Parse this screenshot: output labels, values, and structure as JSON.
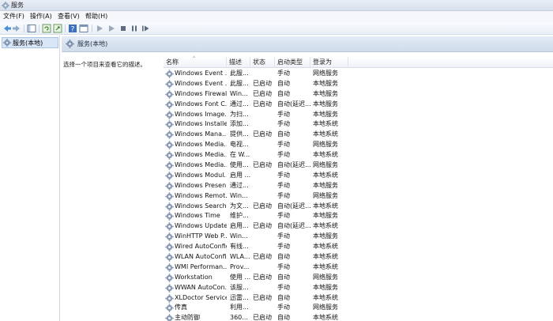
{
  "window": {
    "title": "服务"
  },
  "menu": [
    "文件(F)",
    "操作(A)",
    "查看(V)",
    "帮助(H)"
  ],
  "tree": {
    "root_label": "服务(本地)"
  },
  "main": {
    "header": "服务(本地)",
    "description_hint": "选择一个项目来查看它的描述。",
    "columns": [
      "名称",
      "描述",
      "状态",
      "启动类型",
      "登录为"
    ]
  },
  "services": [
    {
      "name": "Windows Event ...",
      "desc": "此服...",
      "status": "",
      "startup": "手动",
      "logon": "网络服务"
    },
    {
      "name": "Windows Event ...",
      "desc": "此服...",
      "status": "已启动",
      "startup": "自动",
      "logon": "本地服务"
    },
    {
      "name": "Windows Firewall",
      "desc": "Win...",
      "status": "已启动",
      "startup": "自动",
      "logon": "本地服务"
    },
    {
      "name": "Windows Font C...",
      "desc": "通过...",
      "status": "已启动",
      "startup": "自动(延迟...",
      "logon": "本地服务"
    },
    {
      "name": "Windows Image...",
      "desc": "为扫...",
      "status": "",
      "startup": "手动",
      "logon": "本地服务"
    },
    {
      "name": "Windows Installer",
      "desc": "添加...",
      "status": "",
      "startup": "手动",
      "logon": "本地系统"
    },
    {
      "name": "Windows Mana...",
      "desc": "提供...",
      "status": "已启动",
      "startup": "自动",
      "logon": "本地系统"
    },
    {
      "name": "Windows Media...",
      "desc": "电视...",
      "status": "",
      "startup": "手动",
      "logon": "网络服务"
    },
    {
      "name": "Windows Media...",
      "desc": "在 W...",
      "status": "",
      "startup": "手动",
      "logon": "本地系统"
    },
    {
      "name": "Windows Media...",
      "desc": "使用...",
      "status": "已启动",
      "startup": "自动(延迟...",
      "logon": "网络服务"
    },
    {
      "name": "Windows Modul...",
      "desc": "启用 ...",
      "status": "",
      "startup": "手动",
      "logon": "本地系统"
    },
    {
      "name": "Windows Presen...",
      "desc": "通过...",
      "status": "",
      "startup": "手动",
      "logon": "本地服务"
    },
    {
      "name": "Windows Remot...",
      "desc": "Win...",
      "status": "",
      "startup": "手动",
      "logon": "网络服务"
    },
    {
      "name": "Windows Search",
      "desc": "为文...",
      "status": "已启动",
      "startup": "自动(延迟...",
      "logon": "本地系统"
    },
    {
      "name": "Windows Time",
      "desc": "维护...",
      "status": "",
      "startup": "手动",
      "logon": "本地服务"
    },
    {
      "name": "Windows Update",
      "desc": "启用...",
      "status": "已启动",
      "startup": "自动(延迟...",
      "logon": "本地系统"
    },
    {
      "name": "WinHTTP Web P...",
      "desc": "Win...",
      "status": "",
      "startup": "手动",
      "logon": "本地服务"
    },
    {
      "name": "Wired AutoConfig",
      "desc": "有线...",
      "status": "",
      "startup": "手动",
      "logon": "本地系统"
    },
    {
      "name": "WLAN AutoConfig",
      "desc": "WLA...",
      "status": "已启动",
      "startup": "自动",
      "logon": "本地系统"
    },
    {
      "name": "WMI Performan...",
      "desc": "Prov...",
      "status": "",
      "startup": "手动",
      "logon": "本地系统"
    },
    {
      "name": "Workstation",
      "desc": "使用 ...",
      "status": "已启动",
      "startup": "自动",
      "logon": "网络服务"
    },
    {
      "name": "WWAN AutoCon...",
      "desc": "该服...",
      "status": "",
      "startup": "手动",
      "logon": "本地服务"
    },
    {
      "name": "XLDoctor Service",
      "desc": "迅雷...",
      "status": "已启动",
      "startup": "自动",
      "logon": "本地系统"
    },
    {
      "name": "传真",
      "desc": "利用...",
      "status": "",
      "startup": "手动",
      "logon": "网络服务"
    },
    {
      "name": "主动防御",
      "desc": "360...",
      "status": "已启动",
      "startup": "自动",
      "logon": "本地系统"
    }
  ],
  "icons": {
    "app": "services-gear-icon",
    "service": "service-gear-icon",
    "toolbar": [
      "back-icon",
      "forward-icon",
      "console-tree-icon",
      "refresh-icon",
      "export-icon",
      "help-icon",
      "properties-icon",
      "start-icon",
      "start-alt-icon",
      "stop-icon",
      "pause-icon",
      "restart-icon"
    ]
  },
  "colors": {
    "selection": "#d8e6f7",
    "header_band": "#cfdceb",
    "gear": "#7f93ad"
  }
}
